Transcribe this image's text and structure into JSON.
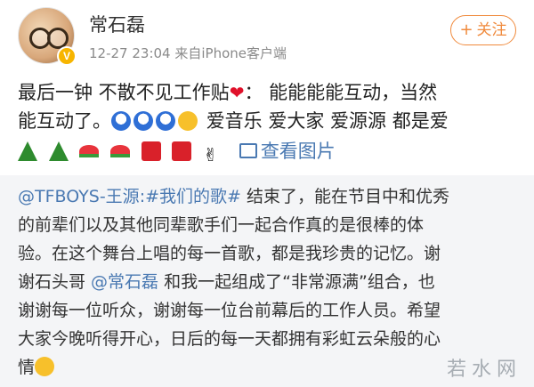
{
  "header": {
    "username": "常石磊",
    "meta": "12-27 23:04  来自iPhone客户端",
    "follow_label": "关注",
    "verified_badge": "V"
  },
  "post": {
    "line1_a": "最后一钟 不散不见工作贴",
    "line1_b": "：  能能能能互动，当然",
    "line2_a": "能互动了。",
    "line2_b": "爱音乐 爱大家 爱源源 都是爱",
    "see_images": "查看图片"
  },
  "quoted": {
    "mention_tfboys": "@TFBOYS-王源",
    "hashtag": ":#我们的歌#",
    "p1": " 结束了，能在节目中和优秀",
    "p2": "的前辈们以及其他同辈歌手们一起合作真的是很棒的体",
    "p3": "验。在这个舞台上唱的每一首歌，都是我珍贵的记忆。谢",
    "p4_a": "谢石头哥 ",
    "mention_csl": "@常石磊",
    "p4_b": " 和我一起组成了“非常源满”组合，也",
    "p5": "谢谢每一位听众，谢谢每一位台前幕后的工作人员。希望",
    "p6": "大家今晚听得开心，日后的每一天都拥有彩虹云朵般的心",
    "p7": "情"
  },
  "watermark": "若水网",
  "colors": {
    "accent": "#f08a3c",
    "link": "#4a79b2",
    "quoted_bg": "#f4f5f7"
  },
  "icons": [
    "heart-icon",
    "shock-emoji-icon",
    "laugh-emoji-icon",
    "christmas-tree-icon",
    "watermelon-icon",
    "red-envelope-icon",
    "victory-hand-icon",
    "image-icon",
    "tongue-emoji-icon",
    "verified-badge-icon"
  ]
}
